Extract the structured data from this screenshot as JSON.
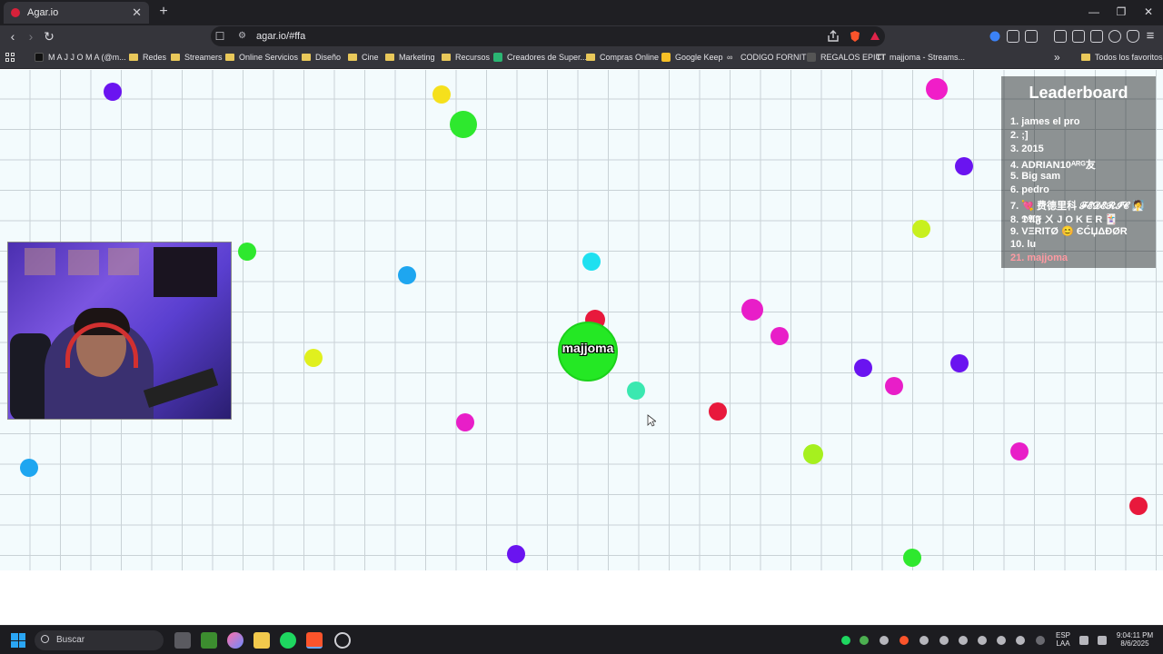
{
  "browser": {
    "tab_title": "Agar.io",
    "tab_close": "✕",
    "new_tab": "+",
    "url": "agar.io/#ffa",
    "bookmarks": [
      "M A J J O M A (@m...",
      "Redes",
      "Streamers",
      "Online Servicios",
      "Diseño",
      "Cine",
      "Marketing",
      "Recursos",
      "Creadores de Super...",
      "Compras Online",
      "Google Keep",
      "CODIGO FORNITE",
      "REGALOS EPIC",
      "majjoma - Streams..."
    ],
    "all_favorites": "Todos los favoritos",
    "overflow": "»"
  },
  "game": {
    "player_name": "majjoma",
    "leaderboard": {
      "title": "Leaderboard",
      "entries": [
        "1. james el pro",
        "2. ;]",
        "3. 2015",
        "4. ADRIAN10ᴬᴿᴳ友",
        "5. Big sam",
        "6. pedro",
        "7. 💘 费德里科 𝓕𝓔𝓓𝓔𝓡𝓘𝓒 🧖",
        "8. 𝕯𝕬𝕱 ㄨ J O K E R 🃏",
        "9. VΞRITØ 😊 ЄĆЏΔĐØR",
        "10. lu"
      ],
      "me": "21. majjoma"
    },
    "colors": {
      "player": "#24e824",
      "grid": "#c9d2d6",
      "background": "#f3fbfd"
    }
  },
  "taskbar": {
    "search_placeholder": "Buscar",
    "lang_top": "ESP",
    "lang_bottom": "LAA",
    "time": "9:04:11 PM",
    "date": "8/6/2025"
  }
}
